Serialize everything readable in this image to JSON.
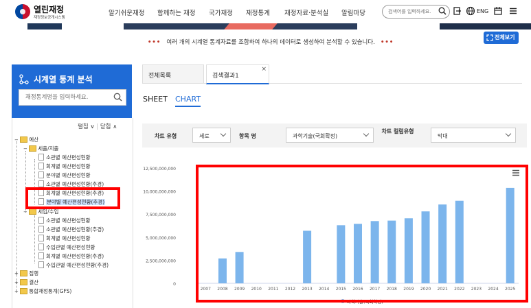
{
  "header": {
    "logo_name": "열린재정",
    "logo_sub": "재정정보공개시스템",
    "nav": [
      "알기쉬운재정",
      "함께하는 재정",
      "국가재정",
      "재정통계",
      "재정자료·분석실",
      "알림마당"
    ],
    "search_placeholder": "검색어를 입력하세요.",
    "lang": "ENG"
  },
  "info_text": "여러 개의 시계열 통계자료를 조합하여 하나의 데이터로 생성하여 분석할 수 있습니다.",
  "info_dots": "•••",
  "fullview_label": "전체보기",
  "sidebar": {
    "title": "시계열 통계 분석",
    "search_placeholder": "재정통계명을 입력하세요.",
    "expand": "펼침",
    "collapse": "닫힘",
    "tree": [
      {
        "label": "예산",
        "type": "folder"
      },
      {
        "label": "세출/지출",
        "type": "folder"
      },
      {
        "label": "소관별 예산편성현황",
        "type": "doc"
      },
      {
        "label": "회계별 예산편성현황",
        "type": "doc"
      },
      {
        "label": "분야별 예산편성현황",
        "type": "doc"
      },
      {
        "label": "소관별 예산편성현황(추경)",
        "type": "doc"
      },
      {
        "label": "회계별 예산편성현황(추경)",
        "type": "doc"
      },
      {
        "label": "분야별 예산편성현황(추경)",
        "type": "doc",
        "selected": true
      },
      {
        "label": "세입/수입",
        "type": "folder"
      },
      {
        "label": "소관별 예산편성현황",
        "type": "doc"
      },
      {
        "label": "소관별 예산편성현황(추경)",
        "type": "doc"
      },
      {
        "label": "회계별 예산편성현황",
        "type": "doc"
      },
      {
        "label": "수입관별 예산편성현황",
        "type": "doc"
      },
      {
        "label": "회계별 예산편성현황(추경)",
        "type": "doc"
      },
      {
        "label": "수입관별 예산편성현황(추경)",
        "type": "doc"
      },
      {
        "label": "집행",
        "type": "folder"
      },
      {
        "label": "결산",
        "type": "folder"
      },
      {
        "label": "통합재정통계(GFS)",
        "type": "folder"
      }
    ]
  },
  "main": {
    "tabs": [
      "전체목록",
      "검색결과1"
    ],
    "close_label": "×",
    "view_tabs": [
      "SHEET",
      "CHART"
    ],
    "options": {
      "chart_type_label": "차트 유형",
      "chart_type_value": "세로",
      "item_label": "항목 명",
      "item_value": "과학기술(국회확정)",
      "series_type_label": "차트 컬럼유형",
      "series_type_value": "막대"
    }
  },
  "chart_data": {
    "type": "bar",
    "categories": [
      "2007",
      "2008",
      "2009",
      "2010",
      "2011",
      "2012",
      "2013",
      "2014",
      "2015",
      "2016",
      "2017",
      "2018",
      "2019",
      "2020",
      "2021",
      "2022",
      "2023",
      "2024",
      "2025"
    ],
    "series": [
      {
        "name": "과학기술(국회확정)",
        "color": "#7cb5ec",
        "values": [
          null,
          2700000000,
          3400000000,
          null,
          null,
          null,
          5700000000,
          null,
          6300000000,
          6450000000,
          6750000000,
          6800000000,
          7050000000,
          7800000000,
          8550000000,
          8950000000,
          null,
          null,
          10350000000
        ]
      }
    ],
    "yticks": [
      "0",
      "2,500,000,000",
      "5,000,000,000",
      "7,500,000,000",
      "10,000,000,000",
      "12,500,000,000"
    ],
    "ylim": [
      0,
      12500000000
    ],
    "grid": false,
    "legend": "bottom"
  }
}
